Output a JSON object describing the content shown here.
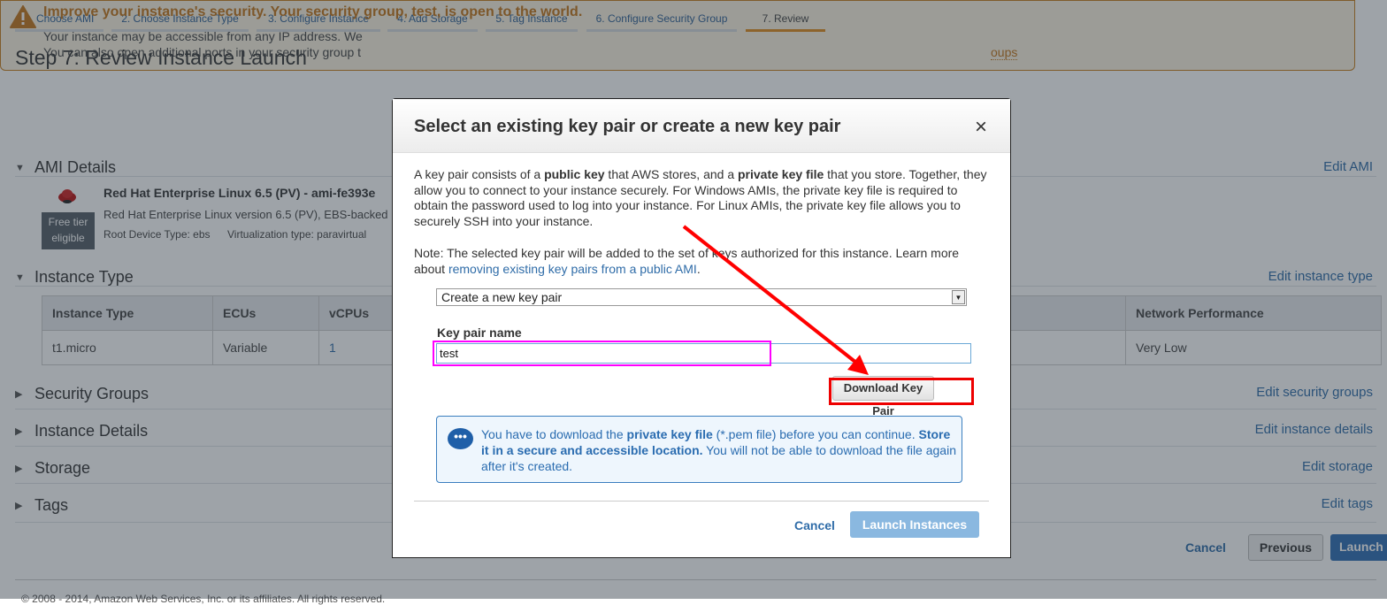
{
  "wizard_tabs": [
    {
      "label": "1. Choose AMI"
    },
    {
      "label": "2. Choose Instance Type"
    },
    {
      "label": "3. Configure Instance"
    },
    {
      "label": "4. Add Storage"
    },
    {
      "label": "5. Tag Instance"
    },
    {
      "label": "6. Configure Security Group"
    },
    {
      "label": "7. Review",
      "active": true
    }
  ],
  "page_title": "Step 7: Review Instance Launch",
  "warning": {
    "heading": "Improve your instance's security. Your security group, test, is open to the world.",
    "line1": "Your instance may be accessible from any IP address. We",
    "line2": "You can also open additional ports in your security group t",
    "link_fragment": "oups",
    "icon": "warning-triangle-icon",
    "color": "#c4761b"
  },
  "ami": {
    "section": "AMI Details",
    "edit": "Edit AMI",
    "name": "Red Hat Enterprise Linux 6.5 (PV) - ami-fe393e",
    "desc": "Red Hat Enterprise Linux version 6.5 (PV), EBS-backed",
    "root_device": "Root Device Type: ebs",
    "virt": "Virtualization type: paravirtual",
    "badge": "Free tier eligible",
    "icon": "redhat-logo-icon"
  },
  "instance_type": {
    "section": "Instance Type",
    "edit": "Edit instance type",
    "headers": [
      "Instance Type",
      "ECUs",
      "vCPUs",
      "Network Performance"
    ],
    "row": [
      "t1.micro",
      "Variable",
      "1",
      "Very Low"
    ]
  },
  "sections": [
    {
      "label": "Security Groups",
      "edit": "Edit security groups"
    },
    {
      "label": "Instance Details",
      "edit": "Edit instance details"
    },
    {
      "label": "Storage",
      "edit": "Edit storage"
    },
    {
      "label": "Tags",
      "edit": "Edit tags"
    }
  ],
  "footer_buttons": {
    "cancel": "Cancel",
    "previous": "Previous",
    "launch": "Launch"
  },
  "footer_text": "© 2008 - 2014, Amazon Web Services, Inc. or its affiliates. All rights reserved.",
  "modal": {
    "title": "Select an existing key pair or create a new key pair",
    "close": "×",
    "p1_a": "A key pair consists of a ",
    "p1_b": "public key",
    "p1_c": " that AWS stores, and a ",
    "p1_d": "private key file",
    "p1_e": " that you store. Together, they allow you to connect to your instance securely. For Windows AMIs, the private key file is required to obtain the password used to log into your instance. For Linux AMIs, the private key file allows you to securely SSH into your instance.",
    "note": "Note: The selected key pair will be added to the set of keys authorized for this instance. Learn more about ",
    "note_link": "removing existing key pairs from a public AMI",
    "select_value": "Create a new key pair",
    "key_label": "Key pair name",
    "key_value": "test",
    "download": "Download Key Pair",
    "info_a": "You have to download the ",
    "info_b": "private key file",
    "info_c": " (*.pem file) before you can continue. ",
    "info_d": "Store it in a secure and accessible location.",
    "info_e": " You will not be able to download the file again after it's created.",
    "cancel": "Cancel",
    "launch": "Launch Instances"
  },
  "annotation_colors": {
    "arrow": "#ff0000",
    "name_highlight": "#ff00ff",
    "button_highlight": "#ee0000"
  }
}
